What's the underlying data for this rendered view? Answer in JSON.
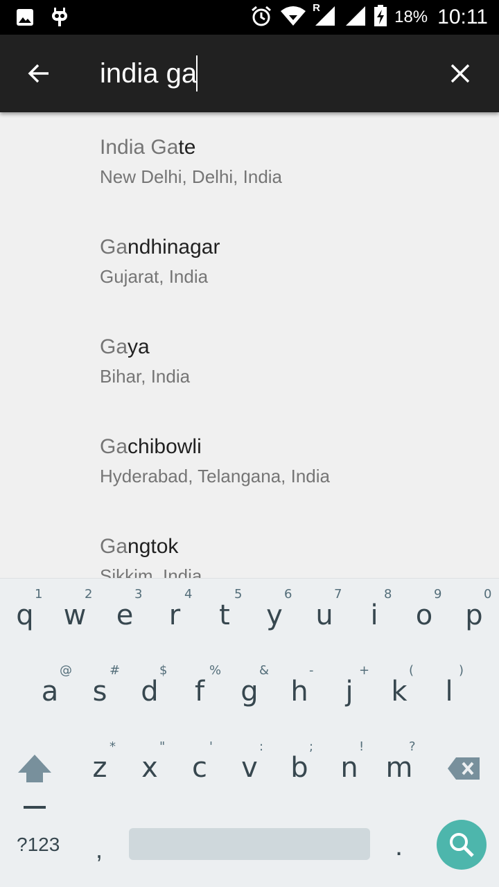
{
  "status_bar": {
    "battery": "18%",
    "time": "10:11",
    "network": "R",
    "icons": [
      "image-icon",
      "cyanogen-icon",
      "alarm-icon",
      "wifi-icon",
      "signal-icon",
      "battery-charging-icon"
    ]
  },
  "toolbar": {
    "back_icon": "arrow-left-icon",
    "query": "india ga",
    "clear_icon": "close-icon",
    "background": "#212121"
  },
  "results": [
    {
      "match": "India Ga",
      "rest": "te",
      "subtitle": "New Delhi, Delhi, India"
    },
    {
      "match": "Ga",
      "rest": "ndhinagar",
      "subtitle": "Gujarat, India"
    },
    {
      "match": "Ga",
      "rest": "ya",
      "subtitle": "Bihar, India"
    },
    {
      "match": "Ga",
      "rest": "chibowli",
      "subtitle": "Hyderabad, Telangana, India"
    },
    {
      "match": "Ga",
      "rest": "ngtok",
      "subtitle": "Sikkim, India"
    }
  ],
  "keyboard": {
    "row1": [
      {
        "ch": "q",
        "hint": "1"
      },
      {
        "ch": "w",
        "hint": "2"
      },
      {
        "ch": "e",
        "hint": "3"
      },
      {
        "ch": "r",
        "hint": "4"
      },
      {
        "ch": "t",
        "hint": "5"
      },
      {
        "ch": "y",
        "hint": "6"
      },
      {
        "ch": "u",
        "hint": "7"
      },
      {
        "ch": "i",
        "hint": "8"
      },
      {
        "ch": "o",
        "hint": "9"
      },
      {
        "ch": "p",
        "hint": "0"
      }
    ],
    "row2": [
      {
        "ch": "a",
        "hint": "@"
      },
      {
        "ch": "s",
        "hint": "#"
      },
      {
        "ch": "d",
        "hint": "$"
      },
      {
        "ch": "f",
        "hint": "%"
      },
      {
        "ch": "g",
        "hint": "&"
      },
      {
        "ch": "h",
        "hint": "-"
      },
      {
        "ch": "j",
        "hint": "+"
      },
      {
        "ch": "k",
        "hint": "("
      },
      {
        "ch": "l",
        "hint": ")"
      }
    ],
    "row3": [
      {
        "ch": "z",
        "hint": "*"
      },
      {
        "ch": "x",
        "hint": "\""
      },
      {
        "ch": "c",
        "hint": "'"
      },
      {
        "ch": "v",
        "hint": ":"
      },
      {
        "ch": "b",
        "hint": ";"
      },
      {
        "ch": "n",
        "hint": "!"
      },
      {
        "ch": "m",
        "hint": "?"
      }
    ],
    "symbols_label": "?123",
    "comma": ",",
    "period": ".",
    "shift_icon": "shift-icon",
    "delete_icon": "backspace-icon",
    "search_icon": "search-icon",
    "accent": "#4db6ac"
  }
}
